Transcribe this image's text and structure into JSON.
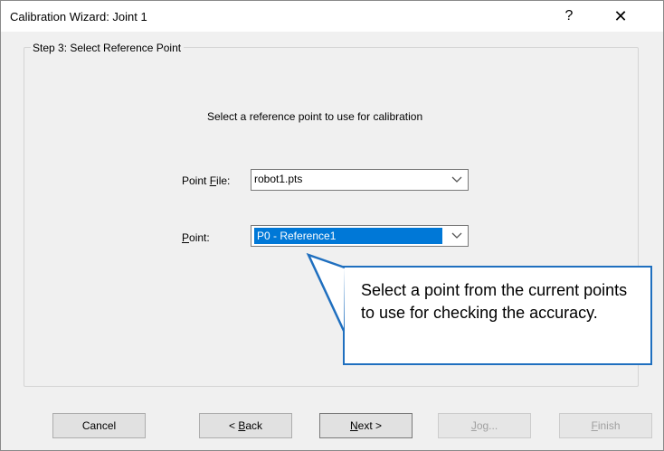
{
  "window": {
    "title": "Calibration Wizard: Joint 1",
    "help_glyph": "?",
    "close_glyph": "✕"
  },
  "step": {
    "legend": "Step 3: Select Reference Point",
    "instruction": "Select a reference point to use for calibration"
  },
  "point_file": {
    "label_pre": "Point ",
    "label_mnemonic": "F",
    "label_post": "ile:",
    "value": "robot1.pts",
    "arrow_icon": "chevron-down-icon"
  },
  "point": {
    "label_pre": "",
    "label_mnemonic": "P",
    "label_post": "oint:",
    "value": "P0 - Reference1",
    "arrow_icon": "chevron-down-icon"
  },
  "callout": {
    "text": "Select a point from the current points to use for checking the accuracy.",
    "border_color": "#1f6fbf"
  },
  "buttons": {
    "cancel": "Cancel",
    "back_pre": "< ",
    "back_mnemonic": "B",
    "back_post": "ack",
    "next_mnemonic": "N",
    "next_post": "ext >",
    "jog_mnemonic": "J",
    "jog_post": "og...",
    "finish_mnemonic": "F",
    "finish_post": "inish"
  },
  "colors": {
    "selection": "#0078d7",
    "dialog_bg": "#f0f0f0"
  }
}
